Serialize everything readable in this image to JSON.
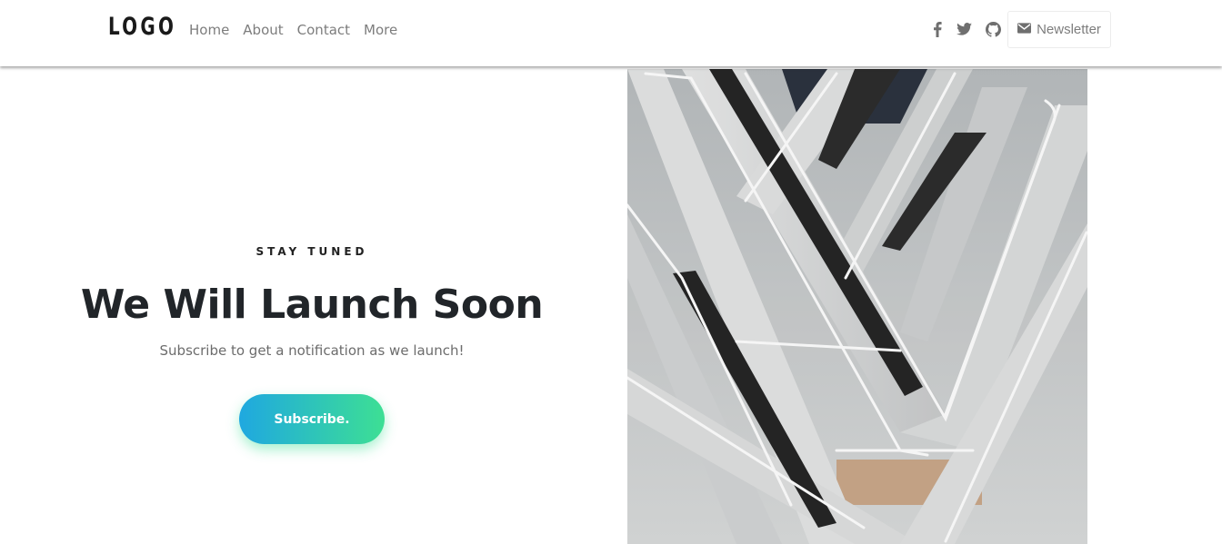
{
  "header": {
    "logo": "LOGO",
    "nav": [
      {
        "label": "Home"
      },
      {
        "label": "About"
      },
      {
        "label": "Contact"
      },
      {
        "label": "More"
      }
    ],
    "social_icons": [
      "facebook-icon",
      "twitter-icon",
      "github-icon"
    ],
    "newsletter_label": "Newsletter",
    "newsletter_icon": "envelope-icon"
  },
  "hero": {
    "eyebrow": "STAY TUNED",
    "title": "We Will Launch Soon",
    "subtitle": "Subscribe to get a notification as we launch!",
    "button_label": "Subscribe.",
    "button_gradient": [
      "#1fa8e0",
      "#3ddf94"
    ]
  },
  "colors": {
    "nav_text": "#7d7d7d",
    "heading": "#212529"
  }
}
